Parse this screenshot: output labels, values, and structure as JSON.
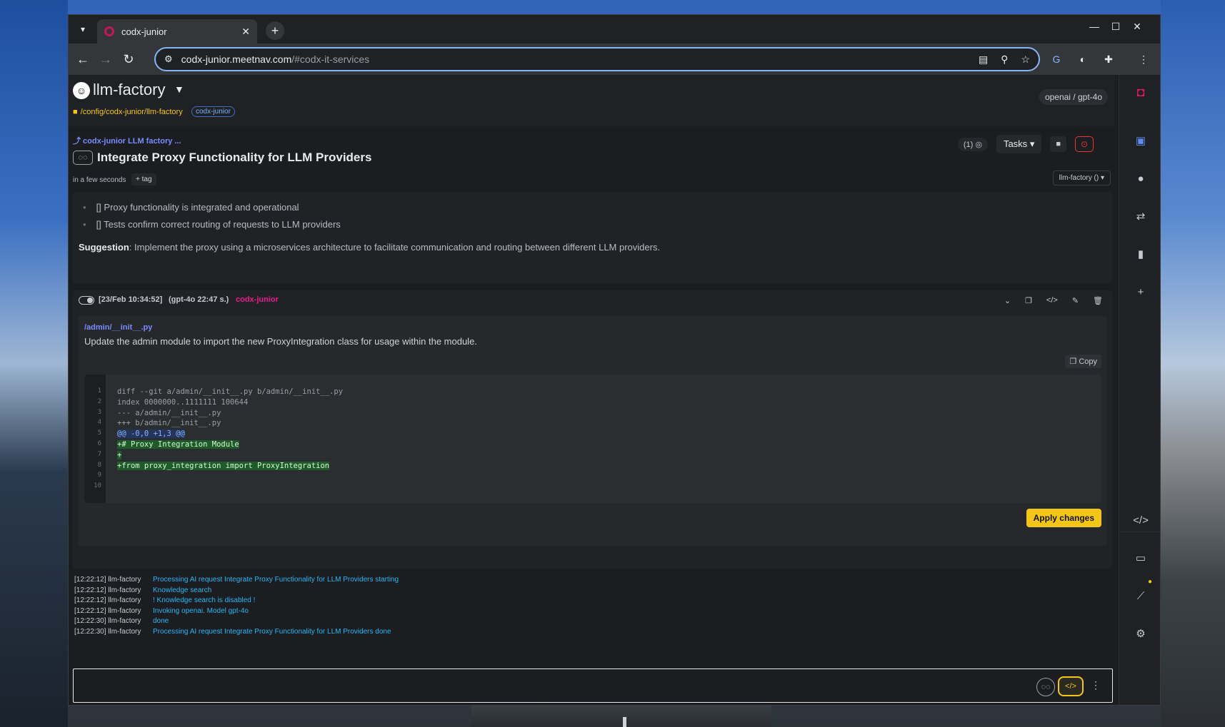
{
  "browser": {
    "tab_title": "codx-junior",
    "url_host": "codx-junior.meetnav.com",
    "url_path": "/#codx-it-services"
  },
  "app": {
    "project_name": "llm-factory",
    "project_path": "/config/codx-junior/llm-factory",
    "project_badge": "codx-junior",
    "model": "openai / gpt-4o"
  },
  "task": {
    "breadcrumb": "⤴ codx-junior LLM factory ...",
    "title": "Integrate Proxy Functionality for LLM Providers",
    "time": "in a few seconds",
    "tag_button": "+ tag",
    "hidden_count": "(1)",
    "tasks_label": "Tasks",
    "branch": "llm-factory ()"
  },
  "description": {
    "bullets": [
      "[] Proxy functionality is integrated and operational",
      "[] Tests confirm correct routing of requests to LLM providers"
    ],
    "suggestion_label": "Suggestion",
    "suggestion_text": ": Implement the proxy using a microservices architecture to facilitate communication and routing between different LLM providers."
  },
  "message": {
    "timestamp": "[23/Feb 10:34:52]",
    "model_info": "(gpt-4o 22:47 s.)",
    "user": "codx-junior",
    "file_path": "/admin/__init__.py",
    "file_description": "Update the admin module to import the new ProxyIntegration class for usage within the module.",
    "copy_label": "Copy",
    "apply_label": "Apply changes",
    "code_lines": [
      {
        "n": "1",
        "text": "diff --git a/admin/__init__.py b/admin/__init__.py",
        "kind": "ctx"
      },
      {
        "n": "2",
        "text": "index 0000000..1111111 100644",
        "kind": "ctx"
      },
      {
        "n": "3",
        "text": "--- a/admin/__init__.py",
        "kind": "ctx"
      },
      {
        "n": "4",
        "text": "+++ b/admin/__init__.py",
        "kind": "ctx"
      },
      {
        "n": "5",
        "text": "@@ -0,0 +1,3 @@",
        "kind": "hunk"
      },
      {
        "n": "6",
        "text": "+# Proxy Integration Module",
        "kind": "add"
      },
      {
        "n": "7",
        "text": "+",
        "kind": "add"
      },
      {
        "n": "8",
        "text": "+from proxy_integration import ProxyIntegration",
        "kind": "add"
      },
      {
        "n": "9",
        "text": "",
        "kind": "ctx"
      },
      {
        "n": "10",
        "text": "",
        "kind": "ctx"
      }
    ]
  },
  "logs": [
    {
      "src": "[12:22:12] llm-factory",
      "msg": "Processing AI request Integrate Proxy Functionality for LLM Providers starting"
    },
    {
      "src": "[12:22:12] llm-factory",
      "msg": "Knowledge search"
    },
    {
      "src": "[12:22:12] llm-factory",
      "msg": "! Knowledge search is disabled !"
    },
    {
      "src": "[12:22:12] llm-factory",
      "msg": "Invoking openai. Model gpt-4o"
    },
    {
      "src": "[12:22:30] llm-factory",
      "msg": "done"
    },
    {
      "src": "[12:22:30] llm-factory",
      "msg": "Processing AI request Integrate Proxy Functionality for LLM Providers done"
    }
  ],
  "colors": {
    "accent_yellow": "#f5c518",
    "link_blue": "#7a8cff",
    "log_blue": "#29b6f6",
    "user_pink": "#e91e8c",
    "diff_add_bg": "#1f5b2a"
  }
}
